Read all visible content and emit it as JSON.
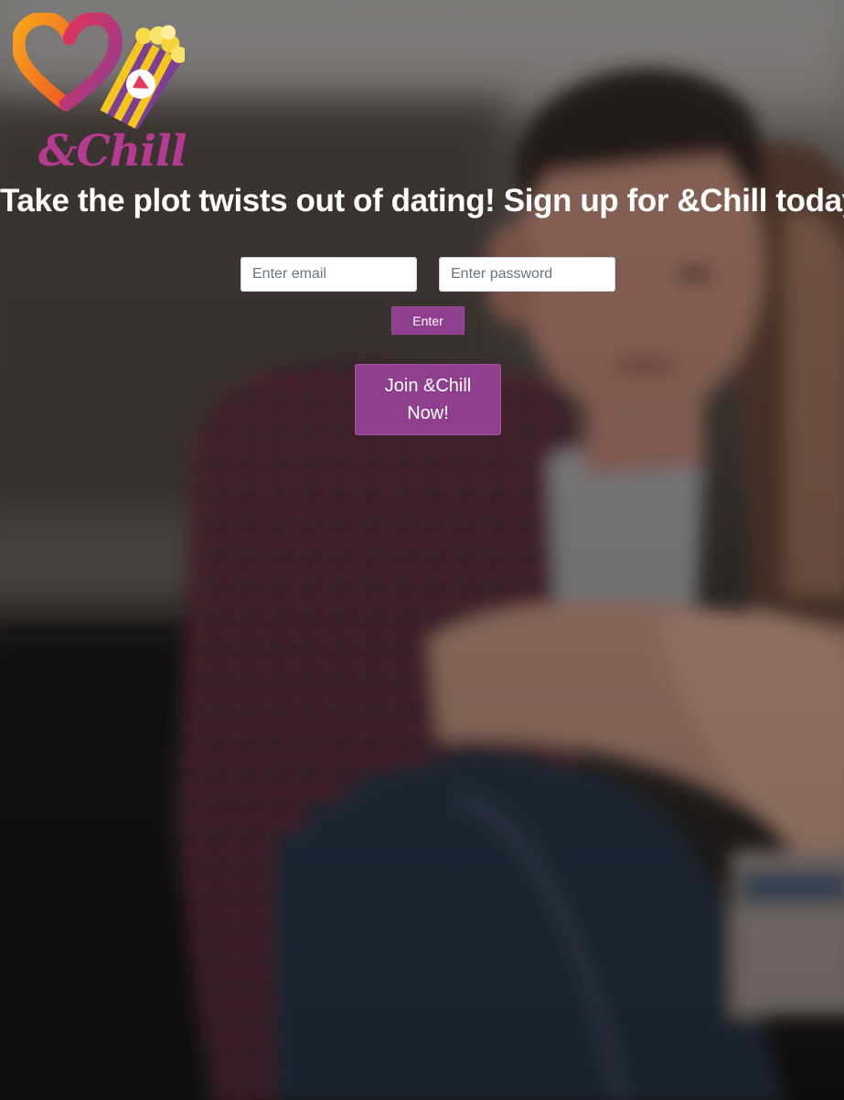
{
  "brand": {
    "name": "&Chill",
    "logo_text": "&Chill",
    "logo_icon": "heart-popcorn-play-logo",
    "colors": {
      "purple": "#8f3f8e",
      "magenta": "#b43a92",
      "orange": "#f39a20",
      "yellow": "#f4c51c"
    }
  },
  "hero": {
    "headline": "Take the plot twists out of dating! Sign up for &Chill today!",
    "background": "blurred-photo-couple-sitting-on-couch"
  },
  "login": {
    "email_placeholder": "Enter email",
    "email_value": "",
    "password_placeholder": "Enter password",
    "password_value": "",
    "enter_label": "Enter"
  },
  "signup": {
    "join_label": "Join &Chill Now!"
  }
}
